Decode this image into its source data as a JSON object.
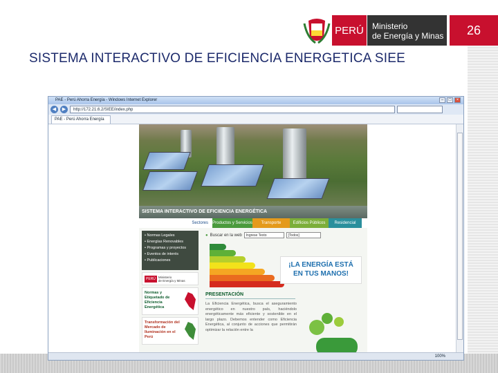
{
  "slide": {
    "title": "SISTEMA INTERACTIVO DE EFICIENCIA ENERGETICA SIEE",
    "page_number": "26",
    "logo": {
      "peru_label": "PERÚ",
      "ministry_line1": "Ministerio",
      "ministry_line2": "de Energía y Minas"
    }
  },
  "browser": {
    "window_title": "PAE - Perú Ahorra Energía - Windows Internet Explorer",
    "url": "http://172.21.6.2/SIEE/index.php",
    "tab_label": "PAE - Perú Ahorra Energía",
    "status_zoom": "100%"
  },
  "website": {
    "banner_title": "SISTEMA INTERACTIVO DE EFICIENCIA ENERGÉTICA",
    "menu_label": "Sectores",
    "menu_items": [
      {
        "label": "Productos y Servicios",
        "color": "#4a9a3d"
      },
      {
        "label": "Transporte",
        "color": "#e49a1c"
      },
      {
        "label": "Edificios Públicos",
        "color": "#7cae3a"
      },
      {
        "label": "Residencial",
        "color": "#2a8f9c"
      }
    ],
    "side_links": [
      "Normas Legales",
      "Energías Renovables",
      "Programas y proyectos",
      "Eventos de interés",
      "Publicaciones"
    ],
    "ministry_card": {
      "peru": "PERÚ",
      "line1": "Ministerio",
      "line2": "de Energía y Minas"
    },
    "promos": [
      "Normas y Etiquetado de Eficiencia Energética",
      "Transformación del Mercado de Iluminación en el Perú"
    ],
    "search": {
      "label": "Buscar en la web",
      "input_value": "Ingrese Texto",
      "select_value": "[Todos]"
    },
    "slogan_line1": "¡LA ENERGÍA ESTÁ",
    "slogan_line2": "EN TUS MANOS!",
    "energy_colors": [
      "#2e8b3a",
      "#5fb038",
      "#b6cf2c",
      "#f2e21b",
      "#f5a623",
      "#ea6b1f",
      "#d52b1e"
    ],
    "presentation_title": "PRESENTACIÓN",
    "presentation_text": "La Eficiencia Energética, busca el aseguramiento energético en nuestro país, haciéndolo energéticamente más eficiente y sostenible en el largo plazo. Debemos entender como Eficiencia Energética, al conjunto de acciones que permitirán optimizar la relación entre la"
  }
}
